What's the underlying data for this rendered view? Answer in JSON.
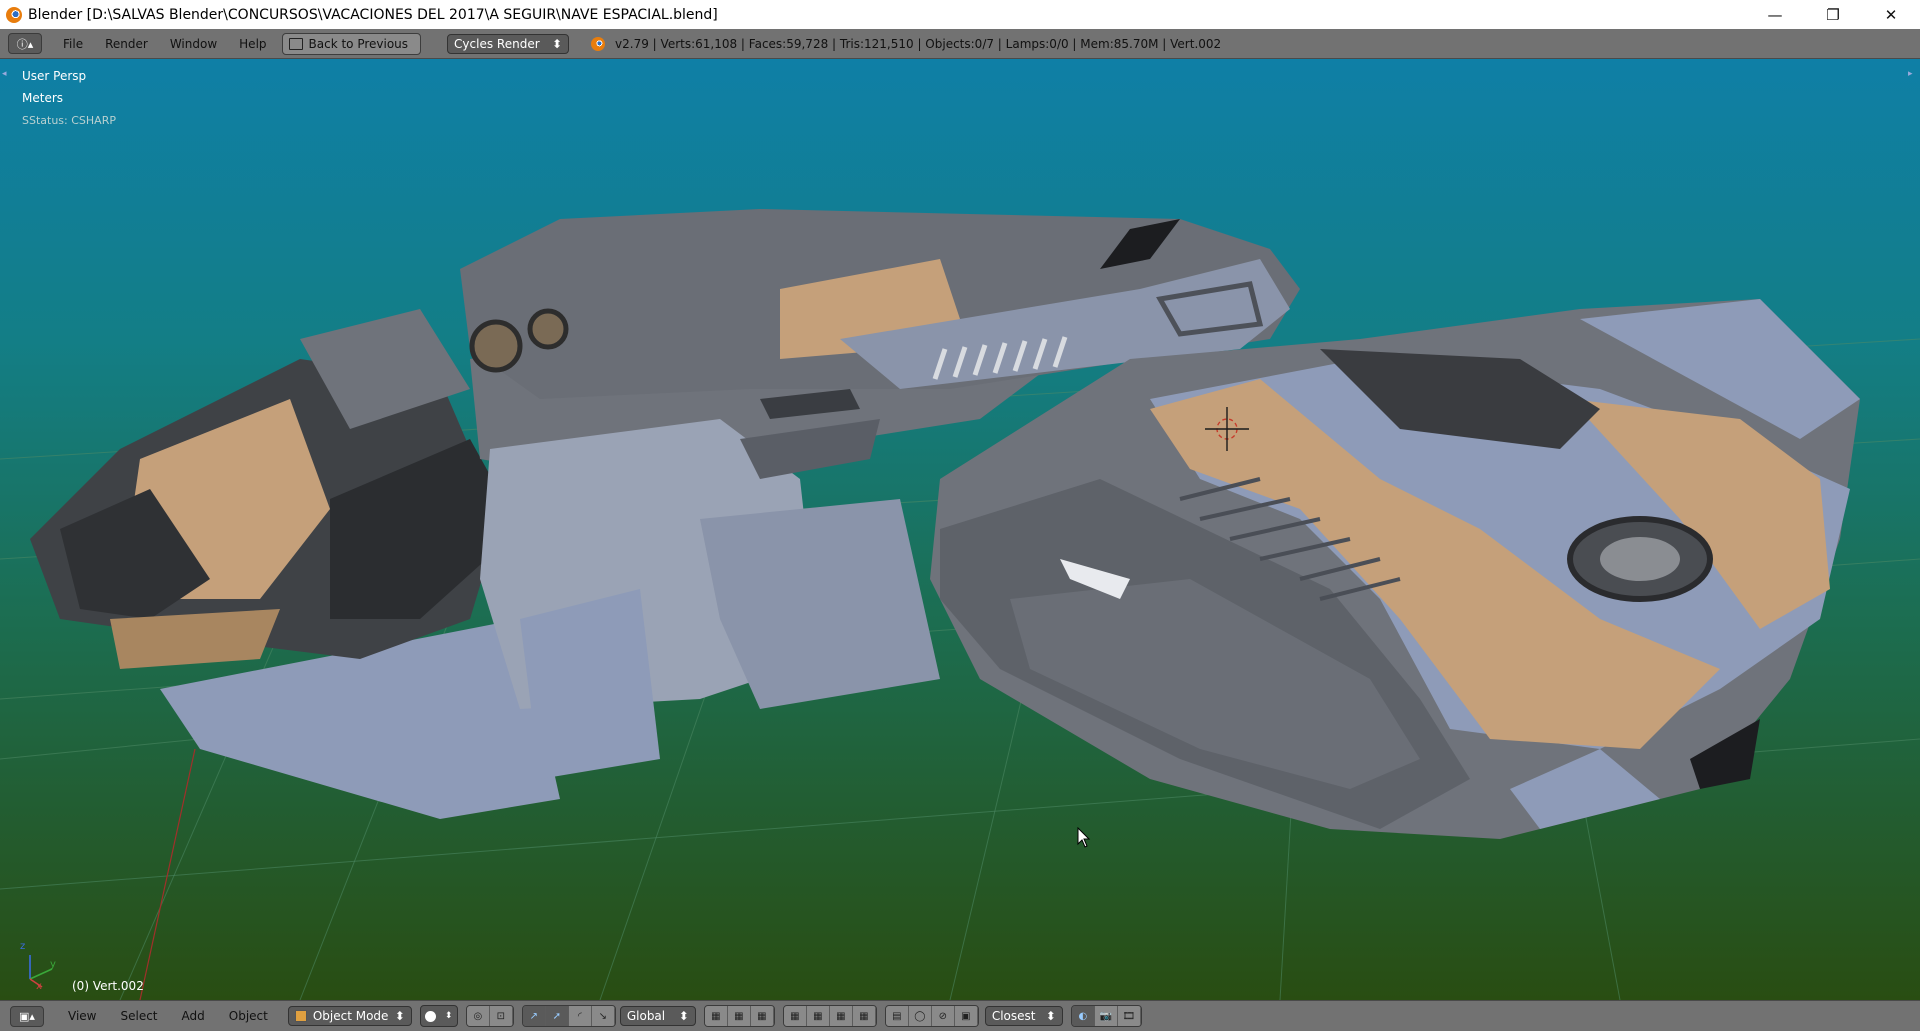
{
  "window": {
    "title": "Blender [D:\\SALVAS Blender\\CONCURSOS\\VACACIONES DEL 2017\\A SEGUIR\\NAVE ESPACIAL.blend]",
    "minimize_glyph": "—",
    "maximize_glyph": "❐",
    "close_glyph": "✕"
  },
  "header": {
    "editor_icon": "info-icon",
    "menus": [
      "File",
      "Render",
      "Window",
      "Help"
    ],
    "back_label": "Back to Previous",
    "render_engine": "Cycles Render",
    "stats": "v2.79 | Verts:61,108 | Faces:59,728 | Tris:121,510 | Objects:0/7 | Lamps:0/0 | Mem:85.70M | Vert.002"
  },
  "viewport": {
    "view_label": "User Persp",
    "units_label": "Meters",
    "status_label": "SStatus: CSHARP",
    "active_object": "(0) Vert.002",
    "axis_y": "y",
    "axis_z": "z",
    "axis_x": "x"
  },
  "footer": {
    "menus": [
      "View",
      "Select",
      "Add",
      "Object"
    ],
    "mode": "Object Mode",
    "orientation": "Global",
    "snap_target": "Closest"
  },
  "colors": {
    "header_bg": "#727272",
    "viewport_top": "#0f7fa6",
    "viewport_bottom": "#294d12",
    "hull_blue": "#8e9bb8",
    "hull_gray": "#6f737b",
    "hull_tan": "#c5a07a"
  }
}
